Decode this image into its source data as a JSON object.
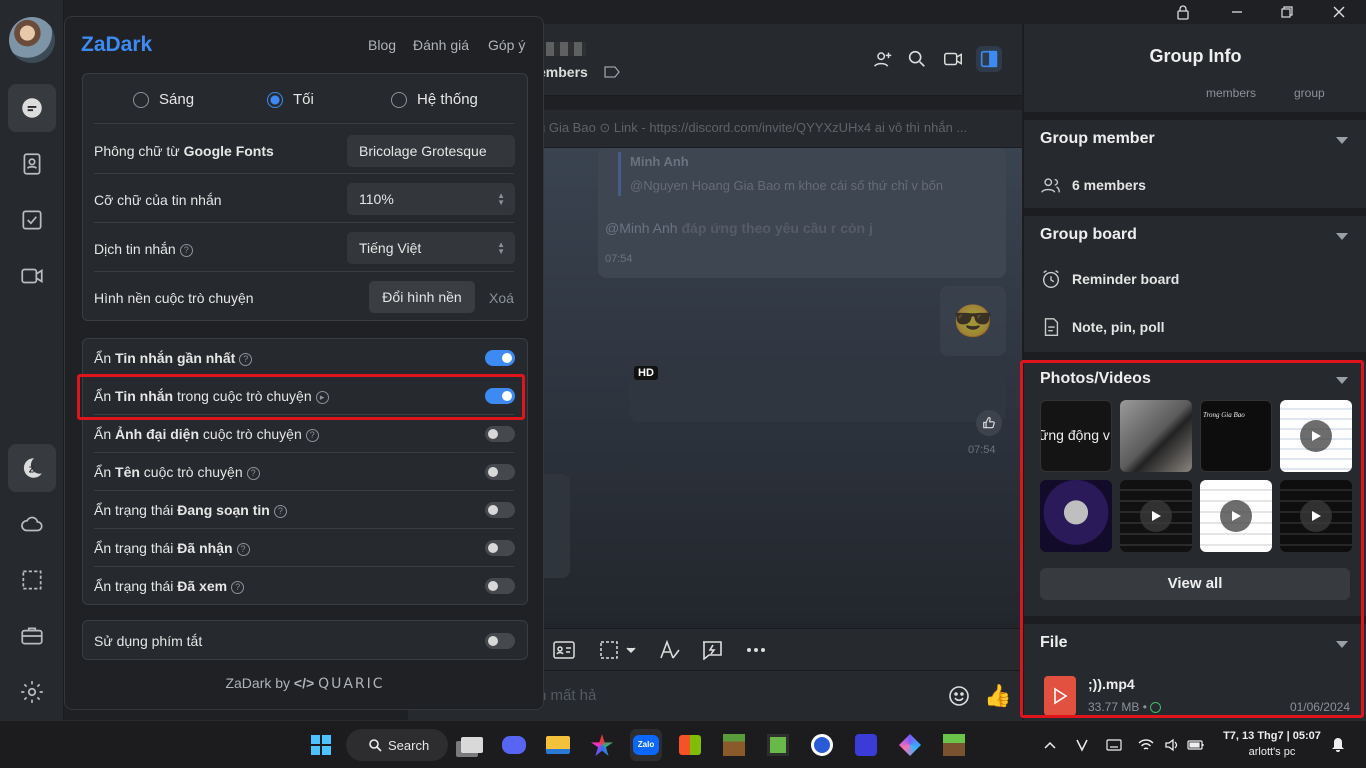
{
  "window": {
    "controls": [
      "lock-icon",
      "minimize-icon",
      "restore-icon",
      "close-icon"
    ]
  },
  "chat": {
    "members_partial": "embers",
    "pinned": "g Gia Bao  ⊙ Link - https://discord.com/invite/QYYXzUHx4 ai vô thì nhắn ...",
    "quote_name": "Minh Anh",
    "quote_text": "@Nguyen Hoang Gia Bao m khoe cái số thứ chỉ v bốn",
    "message_mention": "@Minh Anh",
    "message_text": "đáp ứng theo yêu cầu r còn j",
    "time_1": "07:54",
    "time_2": "07:54",
    "hd_badge": "HD",
    "input_placeholder": "n mất hả"
  },
  "group_info": {
    "title": "Group Info",
    "sub_left": "members",
    "sub_right": "group",
    "member_section": "Group member",
    "members_count": "6 members",
    "board_section": "Group board",
    "reminder": "Reminder board",
    "notes": "Note, pin, poll",
    "photos_section": "Photos/Videos",
    "thumb_text_1": "ững động v",
    "thumb_text_3": "Trong Gia Bao",
    "view_all": "View all",
    "file_section": "File",
    "file_name": ";)).mp4",
    "file_size": "33.77 MB •",
    "file_date": "01/06/2024"
  },
  "zadark": {
    "logo": "ZaDark",
    "links": [
      "Blog",
      "Đánh giá",
      "Góp ý"
    ],
    "themes": [
      "Sáng",
      "Tối",
      "Hệ thống"
    ],
    "selected_theme": "Tối",
    "font_label_prefix": "Phông chữ từ ",
    "font_label_bold": "Google Fonts",
    "font_value": "Bricolage Grotesque",
    "size_label": "Cỡ chữ của tin nhắn",
    "size_value": "110%",
    "translate_label": "Dịch tin nhắn",
    "translate_value": "Tiếng Việt",
    "bg_label": "Hình nền cuộc trò chuyện",
    "bg_button": "Đổi hình nền",
    "bg_delete": "Xoá",
    "toggles": [
      {
        "pre": "Ẩn ",
        "bold": "Tin nhắn gần nhất",
        "post": "",
        "on": true
      },
      {
        "pre": "Ẩn ",
        "bold": "Tin nhắn",
        "post": " trong cuộc trò chuyện",
        "on": true
      },
      {
        "pre": "Ẩn ",
        "bold": "Ảnh đại diện",
        "post": " cuộc trò chuyện",
        "on": false
      },
      {
        "pre": "Ẩn ",
        "bold": "Tên",
        "post": " cuộc trò chuyện",
        "on": false
      },
      {
        "pre": "Ẩn trạng thái ",
        "bold": "Đang soạn tin",
        "post": "",
        "on": false
      },
      {
        "pre": "Ẩn trạng thái ",
        "bold": "Đã nhận",
        "post": "",
        "on": false
      },
      {
        "pre": "Ẩn trạng thái ",
        "bold": "Đã xem",
        "post": "",
        "on": false
      }
    ],
    "shortcut_label": "Sử dụng phím tắt",
    "shortcut_on": false,
    "footer_prefix": "ZaDark by",
    "footer_brand": "QUARIC"
  },
  "taskbar": {
    "search_label": "Search",
    "clock_line1": "T7, 13 Thg7 | 05:07",
    "clock_line2": "arlott's pc"
  },
  "colors": {
    "accent": "#3d8bf2",
    "highlight": "#e0141b"
  }
}
